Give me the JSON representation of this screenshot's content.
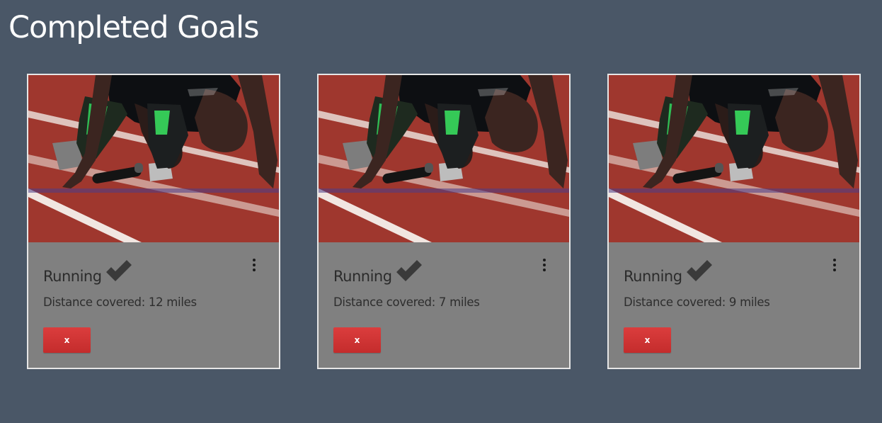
{
  "page": {
    "title": "Completed Goals"
  },
  "colors": {
    "background": "#4a5767",
    "card_body": "#808080",
    "track": "#a83c32",
    "button": "#d43535"
  },
  "cards": [
    {
      "image": "runner-starting-block-photo",
      "title": "Running",
      "status_icon": "check-icon",
      "menu_icon": "kebab-menu-icon",
      "distance_text": "Distance covered: 12 miles",
      "remove_label": "x"
    },
    {
      "image": "runner-starting-block-photo",
      "title": "Running",
      "status_icon": "check-icon",
      "menu_icon": "kebab-menu-icon",
      "distance_text": "Distance covered: 7 miles",
      "remove_label": "x"
    },
    {
      "image": "runner-starting-block-photo",
      "title": "Running",
      "status_icon": "check-icon",
      "menu_icon": "kebab-menu-icon",
      "distance_text": "Distance covered: 9 miles",
      "remove_label": "x"
    }
  ]
}
